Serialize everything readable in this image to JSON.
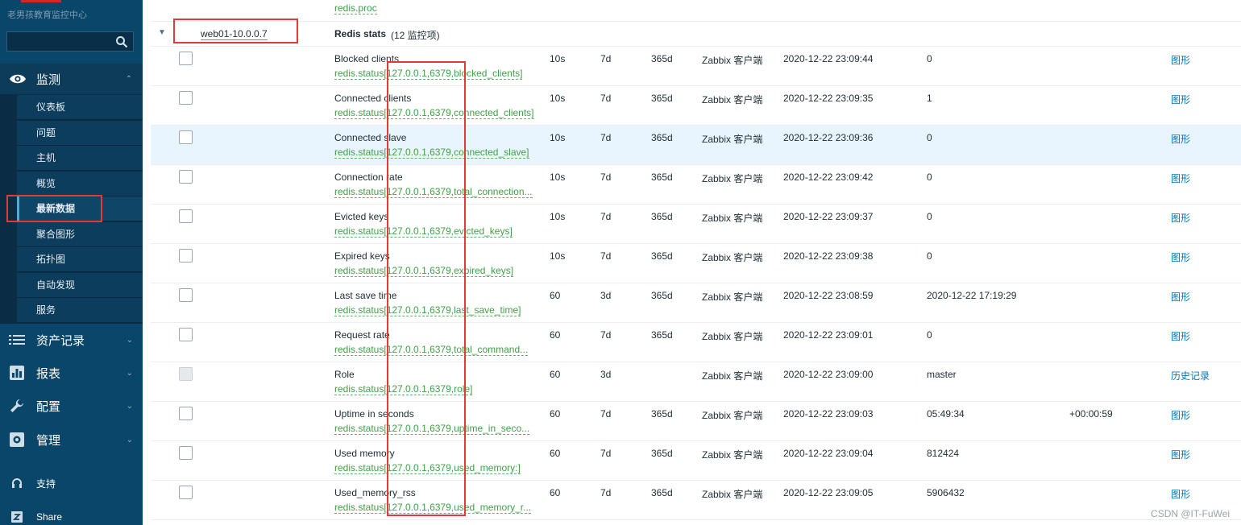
{
  "sidebar": {
    "brand": "老男孩教育监控中心",
    "search_placeholder": "",
    "monitor": {
      "label": "监测",
      "icon": "eye-icon"
    },
    "monitor_items": [
      {
        "label": "仪表板"
      },
      {
        "label": "问题"
      },
      {
        "label": "主机"
      },
      {
        "label": "概览"
      },
      {
        "label": "最新数据"
      },
      {
        "label": "聚合图形"
      },
      {
        "label": "拓扑图"
      },
      {
        "label": "自动发现"
      },
      {
        "label": "服务"
      }
    ],
    "active_item": "最新数据",
    "sections": [
      {
        "label": "资产记录",
        "icon": "list-icon"
      },
      {
        "label": "报表",
        "icon": "bar-chart-icon"
      },
      {
        "label": "配置",
        "icon": "wrench-icon"
      },
      {
        "label": "管理",
        "icon": "gear-icon"
      }
    ],
    "support": {
      "label": "支持",
      "icon": "headset-icon"
    },
    "share": {
      "label": "Share",
      "icon": "zabbix-share-icon"
    }
  },
  "table": {
    "top_key": "redis.proc",
    "group": {
      "host": "web01-10.0.0.7",
      "title": "Redis stats",
      "count": "(12 监控项)"
    },
    "rows": [
      {
        "name": "Blocked clients",
        "key": "redis.status[127.0.0.1,6379,blocked_clients]",
        "interval": "10s",
        "history": "7d",
        "trends": "365d",
        "type": "Zabbix 客户端",
        "last_check": "2020-12-22 23:09:44",
        "last_value": "0",
        "change": "",
        "action": "图形",
        "disabled": false,
        "highlight": false
      },
      {
        "name": "Connected clients",
        "key": "redis.status[127.0.0.1,6379,connected_clients]",
        "interval": "10s",
        "history": "7d",
        "trends": "365d",
        "type": "Zabbix 客户端",
        "last_check": "2020-12-22 23:09:35",
        "last_value": "1",
        "change": "",
        "action": "图形",
        "disabled": false,
        "highlight": false
      },
      {
        "name": "Connected slave",
        "key": "redis.status[127.0.0.1,6379,connected_slave]",
        "interval": "10s",
        "history": "7d",
        "trends": "365d",
        "type": "Zabbix 客户端",
        "last_check": "2020-12-22 23:09:36",
        "last_value": "0",
        "change": "",
        "action": "图形",
        "disabled": false,
        "highlight": true
      },
      {
        "name": "Connection rate",
        "key": "redis.status[127.0.0.1,6379,total_connection...",
        "interval": "10s",
        "history": "7d",
        "trends": "365d",
        "type": "Zabbix 客户端",
        "last_check": "2020-12-22 23:09:42",
        "last_value": "0",
        "change": "",
        "action": "图形",
        "disabled": false,
        "highlight": false
      },
      {
        "name": "Evicted keys",
        "key": "redis.status[127.0.0.1,6379,evicted_keys]",
        "interval": "10s",
        "history": "7d",
        "trends": "365d",
        "type": "Zabbix 客户端",
        "last_check": "2020-12-22 23:09:37",
        "last_value": "0",
        "change": "",
        "action": "图形",
        "disabled": false,
        "highlight": false
      },
      {
        "name": "Expired keys",
        "key": "redis.status[127.0.0.1,6379,expired_keys]",
        "interval": "10s",
        "history": "7d",
        "trends": "365d",
        "type": "Zabbix 客户端",
        "last_check": "2020-12-22 23:09:38",
        "last_value": "0",
        "change": "",
        "action": "图形",
        "disabled": false,
        "highlight": false
      },
      {
        "name": "Last save time",
        "key": "redis.status[127.0.0.1,6379,last_save_time]",
        "interval": "60",
        "history": "3d",
        "trends": "365d",
        "type": "Zabbix 客户端",
        "last_check": "2020-12-22 23:08:59",
        "last_value": "2020-12-22 17:19:29",
        "change": "",
        "action": "图形",
        "disabled": false,
        "highlight": false
      },
      {
        "name": "Request rate",
        "key": "redis.status[127.0.0.1,6379,total_command...",
        "interval": "60",
        "history": "7d",
        "trends": "365d",
        "type": "Zabbix 客户端",
        "last_check": "2020-12-22 23:09:01",
        "last_value": "0",
        "change": "",
        "action": "图形",
        "disabled": false,
        "highlight": false
      },
      {
        "name": "Role",
        "key": "redis.status[127.0.0.1,6379,role]",
        "interval": "60",
        "history": "3d",
        "trends": "",
        "type": "Zabbix 客户端",
        "last_check": "2020-12-22 23:09:00",
        "last_value": "master",
        "change": "",
        "action": "历史记录",
        "disabled": true,
        "highlight": false
      },
      {
        "name": "Uptime in seconds",
        "key": "redis.status[127.0.0.1,6379,uptime_in_seco...",
        "interval": "60",
        "history": "7d",
        "trends": "365d",
        "type": "Zabbix 客户端",
        "last_check": "2020-12-22 23:09:03",
        "last_value": "05:49:34",
        "change": "+00:00:59",
        "action": "图形",
        "disabled": false,
        "highlight": false
      },
      {
        "name": "Used memory",
        "key": "redis.status[127.0.0.1,6379,used_memory:]",
        "interval": "60",
        "history": "7d",
        "trends": "365d",
        "type": "Zabbix 客户端",
        "last_check": "2020-12-22 23:09:04",
        "last_value": "812424",
        "change": "",
        "action": "图形",
        "disabled": false,
        "highlight": false
      },
      {
        "name": "Used_memory_rss",
        "key": "redis.status[127.0.0.1,6379,used_memory_r...",
        "interval": "60",
        "history": "7d",
        "trends": "365d",
        "type": "Zabbix 客户端",
        "last_check": "2020-12-22 23:09:05",
        "last_value": "5906432",
        "change": "",
        "action": "图形",
        "disabled": false,
        "highlight": false
      }
    ]
  },
  "watermark": "CSDN @IT-FuWei",
  "colors": {
    "sidebar_bg": "#0a466a",
    "key_green": "#429e47",
    "link_blue": "#0275b8",
    "annotation_red": "#e23a3a",
    "row_highlight": "#e8f5ff"
  }
}
